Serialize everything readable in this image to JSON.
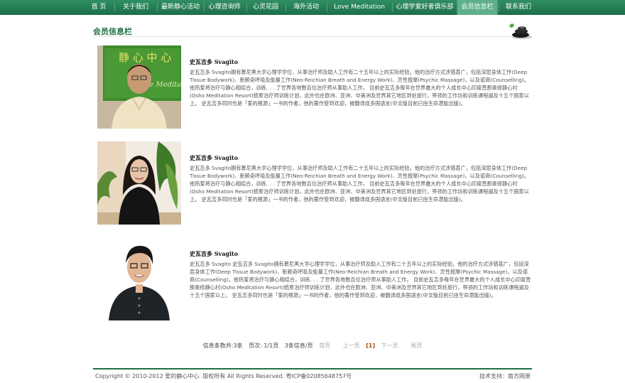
{
  "nav": {
    "items": [
      "首 页",
      "关于我们",
      "最新静心活动",
      "心理咨询师",
      "心灵花园",
      "海外活动",
      "Love Meditation",
      "心理学爱好者俱乐部",
      "会员信息栏",
      "联系我们"
    ],
    "active_index": 8
  },
  "section": {
    "title": "会员信息栏"
  },
  "members": [
    {
      "name": "史瓦吉多 Svagito",
      "bio": "史瓦吉多 Svagito拥有慕尼黑大学心理学学位，从事治疗师及助人工作有二十五年以上的实际经验。他的治疗方式涉猎甚广，包括深层身体工作(Deep Tissue Bodywork)、新赖奇呼吸及能量工作(Neo-Reichian Breath and Energy Work)、灵性按摩(Psychic Massage)，以及诺商(Counselling)。他热爱将治疗与静心相结合，训练. . . 了世界各地数百位治疗师从事助人工作。 目前史瓦吉多每年在世界最大的个人成长中心印度普那奥修静心村(Osho Meditation Resort)统筹治疗师训练计划，此外也在欧洲、亚洲、中美洲及世界其它地区到处旅行，带领的工作坊和训练课程遍及十五个国家以上。 史瓦吉多同时也是「爱的根源」一书的作者，他的著作受到欢迎，被翻译成多国语言(中文版目前已由生命潜能出版)。"
    },
    {
      "name": "史瓦吉多 Svagito",
      "bio": "史瓦吉多 Svagito拥有慕尼黑大学心理学学位，从事治疗师及助人工作有二十五年以上的实际经验。他的治疗方式涉猎甚广，包括深层身体工作(Deep Tissue Bodywork)、新赖奇呼吸及能量工作(Neo-Reichian Breath and Energy Work)、灵性按摩(Psychic Massage)，以及诺商(Counselling)。他热爱将治疗与静心相结合，训练. . . 了世界各地数百位治疗师从事助人工作。 目前史瓦吉多每年在世界最大的个人成长中心印度普那奥修静心村(Osho Meditation Resort)统筹治疗师训练计划，此外也在欧洲、亚洲、中美洲及世界其它地区到处旅行，带领的工作坊和训练课程遍及十五个国家以上。 史瓦吉多同时也是「爱的根源」一书的作者，他的著作受到欢迎，被翻译成多国语言(中文版目前已由生命潜能出版)。"
    },
    {
      "name": "史瓦吉多 Svagito",
      "bio": "史瓦吉多 Svagito 史瓦吉多 Svagito拥有慕尼黑大学心理学学位，从事治疗师及助人工作有二十五年以上的实际经验。他的治疗方式涉猎甚广，包括深层身体工作(Deep Tissue Bodywork)、新赖奇呼吸及能量工作(Neo-Reichian Breath and Energy Work)、灵性按摩(Psychic Massage)，以及诺商(Counselling)。他热爱将治疗与静心相结合，训练. . . 了世界各地数百位治疗师从事助人工作。 目前史瓦吉多每年在世界最大的个人成长中心印度普那奥修静心村(Osho Meditation Resort)统筹治疗师训练计划，此外也在欧洲、亚洲、中美洲及世界其它地区到处旅行，带领的工作坊和训练课程遍及十五个国家以上。 史瓦吉多同时也是「爱的根源」一书的作者，他的著作受到欢迎，被翻译成多国语言(中文版目前已由生命潜能出版)。"
    }
  ],
  "pager": {
    "info_count": "信息条数共:3条",
    "info_pages": "页次: 1/1页",
    "info_per_page": "3条信息/页",
    "first": "首页",
    "prev": "上一页",
    "current": "[1]",
    "next": "下一页",
    "last": "尾页"
  },
  "footer": {
    "copyright": "Copyright © 2010-2012 爱的静心中心. 版权所有 All Rights Reserved.   粤ICP备02085648757号",
    "support": "技术支持：南方网景"
  },
  "colors": {
    "nav_green": "#1d6f49",
    "accent": "#1f6f47",
    "active_tab": "#5fb08a"
  }
}
